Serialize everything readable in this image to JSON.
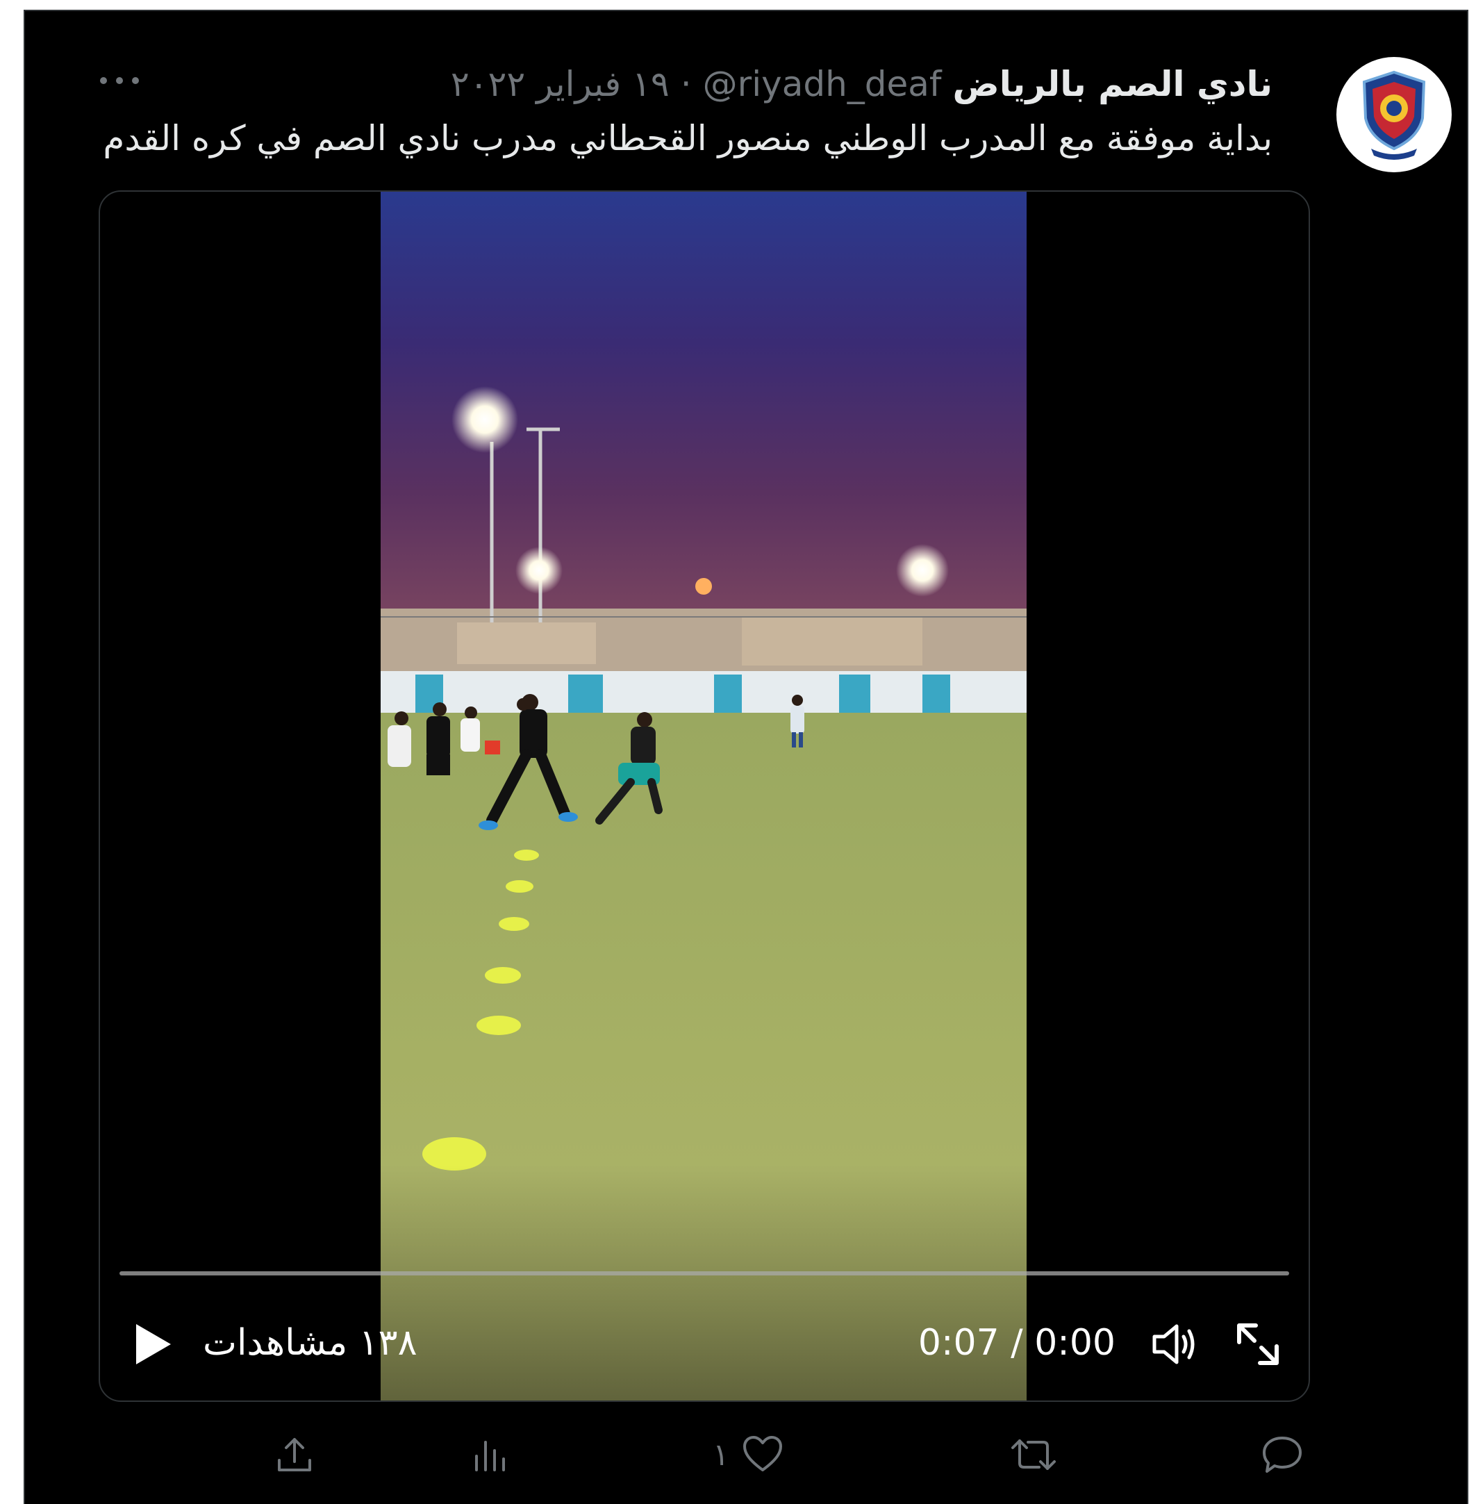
{
  "tweet": {
    "display_name": "نادي الصم بالرياض",
    "handle": "@riyadh_deaf",
    "separator": "·",
    "date": "١٩ فبراير ٢٠٢٢",
    "text": "بداية موفقة مع المدرب الوطني منصور القحطاني مدرب نادي الصم في كره القدم",
    "avatar_icon": "club-crest-icon",
    "more_icon": "more-dots-icon"
  },
  "video": {
    "views_label": "١٣٨ مشاهدات",
    "timecode": "0:07 / 0:00",
    "progress_fraction": 0,
    "play_icon": "play-icon",
    "volume_icon": "volume-icon",
    "fullscreen_icon": "fullscreen-icon"
  },
  "actions": {
    "reply_icon": "reply-icon",
    "retweet_icon": "retweet-icon",
    "like_icon": "heart-icon",
    "like_count": "١",
    "analytics_icon": "analytics-icon",
    "share_icon": "share-icon"
  },
  "colors": {
    "background": "#000000",
    "text_primary": "#e7e9ea",
    "text_secondary": "#71767b",
    "border": "#2f3336"
  }
}
